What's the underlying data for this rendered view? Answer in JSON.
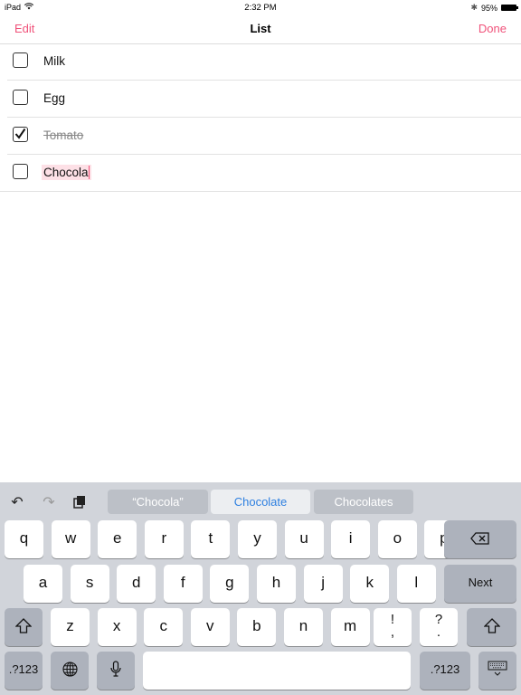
{
  "status_bar": {
    "device": "iPad",
    "time": "2:32 PM",
    "battery": "95%"
  },
  "nav": {
    "title": "List",
    "left_button": "Edit",
    "right_button": "Done",
    "accent": "#f0527a"
  },
  "list": {
    "items": [
      {
        "text": "Milk",
        "checked": false
      },
      {
        "text": "Egg",
        "checked": false
      },
      {
        "text": "Tomato",
        "checked": true
      },
      {
        "text": "Chocola",
        "checked": false,
        "editing": true
      }
    ]
  },
  "keyboard": {
    "suggestions": [
      "“Chocola”",
      "Chocolate",
      "Chocolates"
    ],
    "row1": [
      "q",
      "w",
      "e",
      "r",
      "t",
      "y",
      "u",
      "i",
      "o",
      "p"
    ],
    "row2": [
      "a",
      "s",
      "d",
      "f",
      "g",
      "h",
      "j",
      "k",
      "l"
    ],
    "row3": [
      "z",
      "x",
      "c",
      "v",
      "b",
      "n",
      "m"
    ],
    "punct1": {
      "top": "!",
      "bottom": ","
    },
    "punct2": {
      "top": "?",
      "bottom": "."
    },
    "next_label": "Next",
    "numbers_label": ".?123",
    "icons": {
      "undo": "undo-icon",
      "redo": "redo-icon",
      "paste": "paste-icon",
      "delete": "backspace-icon",
      "shift": "shift-icon",
      "globe": "globe-icon",
      "mic": "microphone-icon",
      "dismiss": "keyboard-dismiss-icon"
    }
  }
}
